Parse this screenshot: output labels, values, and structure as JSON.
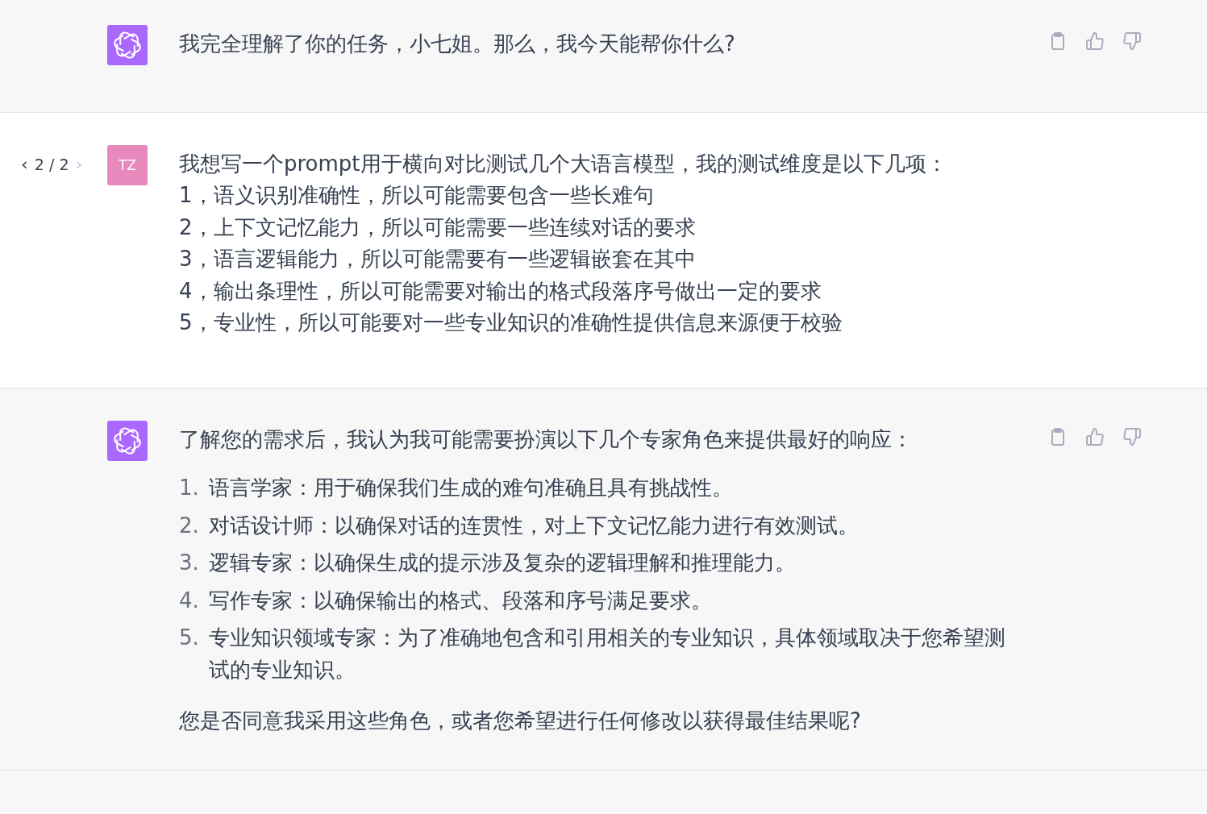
{
  "messages": [
    {
      "kind": "assistant",
      "blocks": [
        {
          "kind": "paragraph",
          "text": "我完全理解了你的任务，小七姐。那么，我今天能帮你什么?"
        }
      ]
    },
    {
      "kind": "user",
      "avatar": "TZ",
      "navigator": {
        "prev": "‹",
        "count": "2 / 2",
        "next": "›",
        "prev_disabled": false,
        "next_disabled": true
      },
      "blocks": [
        {
          "kind": "lines",
          "lines": [
            "我想写一个prompt用于横向对比测试几个大语言模型，我的测试维度是以下几项：",
            "1，语义识别准确性，所以可能需要包含一些长难句",
            "2，上下文记忆能力，所以可能需要一些连续对话的要求",
            "3，语言逻辑能力，所以可能需要有一些逻辑嵌套在其中",
            "4，输出条理性，所以可能需要对输出的格式段落序号做出一定的要求",
            "5，专业性，所以可能要对一些专业知识的准确性提供信息来源便于校验"
          ]
        }
      ]
    },
    {
      "kind": "assistant",
      "blocks": [
        {
          "kind": "paragraph",
          "text": "了解您的需求后，我认为我可能需要扮演以下几个专家角色来提供最好的响应："
        },
        {
          "kind": "list",
          "items": [
            {
              "marker": "1.",
              "text": "语言学家：用于确保我们生成的难句准确且具有挑战性。"
            },
            {
              "marker": "2.",
              "text": "对话设计师：以确保对话的连贯性，对上下文记忆能力进行有效测试。"
            },
            {
              "marker": "3.",
              "text": "逻辑专家：以确保生成的提示涉及复杂的逻辑理解和推理能力。"
            },
            {
              "marker": "4.",
              "text": "写作专家：以确保输出的格式、段落和序号满足要求。"
            },
            {
              "marker": "5.",
              "text": "专业知识领域专家：为了准确地包含和引用相关的专业知识，具体领域取决于您希望测试的专业知识。"
            }
          ]
        },
        {
          "kind": "paragraph",
          "text": "您是否同意我采用这些角色，或者您希望进行任何修改以获得最佳结果呢?"
        }
      ]
    }
  ]
}
